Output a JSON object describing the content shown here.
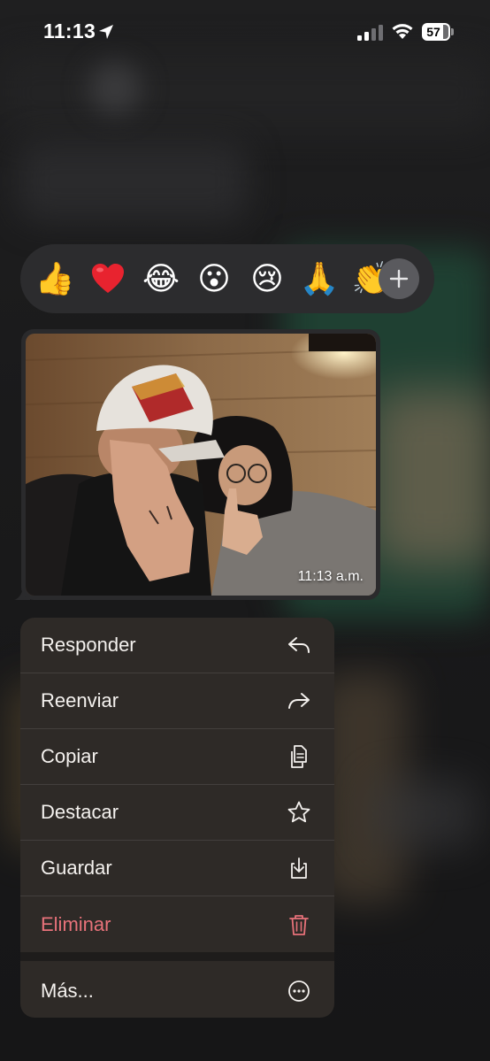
{
  "status_bar": {
    "time": "11:13",
    "battery": "57"
  },
  "reactions": [
    {
      "icon": "thumbs-up-emoji",
      "glyph": "👍"
    },
    {
      "icon": "red-heart-emoji",
      "glyph": "❤️"
    },
    {
      "icon": "tears-of-joy-emoji",
      "glyph": "😂"
    },
    {
      "icon": "surprised-face-emoji",
      "glyph": "😮"
    },
    {
      "icon": "crying-face-emoji",
      "glyph": "😢"
    },
    {
      "icon": "praying-hands-emoji",
      "glyph": "🙏"
    },
    {
      "icon": "clapping-hands-emoji",
      "glyph": "👏"
    }
  ],
  "message": {
    "time": "11:13 a.m."
  },
  "menu": {
    "responder": "Responder",
    "reenviar": "Reenviar",
    "copiar": "Copiar",
    "destacar": "Destacar",
    "guardar": "Guardar",
    "eliminar": "Eliminar",
    "mas": "Más..."
  },
  "colors": {
    "danger": "#e8727a",
    "menu_background": "#2e2a27",
    "reaction_bar": "#2c2c2e"
  }
}
